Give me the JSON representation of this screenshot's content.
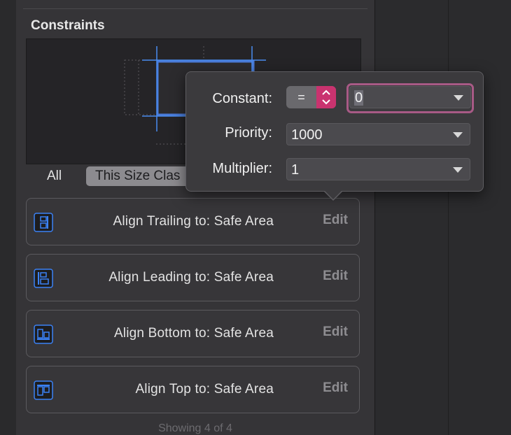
{
  "inspector": {
    "section_title": "Constraints",
    "segments": {
      "all_label": "All",
      "selected_label": "This Size Clas"
    },
    "constraints": [
      {
        "label": "Align Trailing to:  Safe Area",
        "edit_label": "Edit",
        "icon": "align-trailing-icon"
      },
      {
        "label": "Align Leading to:  Safe Area",
        "edit_label": "Edit",
        "icon": "align-leading-icon"
      },
      {
        "label": "Align Bottom to:  Safe Area",
        "edit_label": "Edit",
        "icon": "align-bottom-icon"
      },
      {
        "label": "Align Top to:  Safe Area",
        "edit_label": "Edit",
        "icon": "align-top-icon"
      }
    ],
    "footer": "Showing 4 of 4"
  },
  "popover": {
    "constant_label": "Constant:",
    "relation_symbol": "=",
    "constant_value": "0",
    "priority_label": "Priority:",
    "priority_value": "1000",
    "multiplier_label": "Multiplier:",
    "multiplier_value": "1"
  },
  "colors": {
    "accent_blue": "#3b82f6",
    "focus_ring": "#a85a86",
    "stepper_pink": "#c9336f"
  }
}
